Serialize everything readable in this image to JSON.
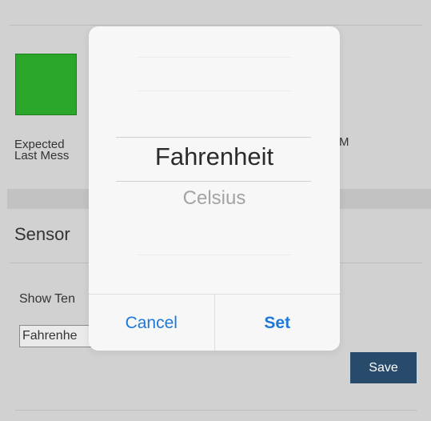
{
  "status": {
    "expected_label": "Expected",
    "last_message_label": "Last Mess",
    "right_fragment": "M",
    "indicator_color": "#2aa62a"
  },
  "sensor_section": {
    "title": "Sensor"
  },
  "temperature_setting": {
    "label": "Show Ten",
    "select_value": "Fahrenhe",
    "save_label": "Save"
  },
  "picker": {
    "selected_option": "Fahrenheit",
    "next_option": "Celsius",
    "cancel_label": "Cancel",
    "set_label": "Set"
  }
}
